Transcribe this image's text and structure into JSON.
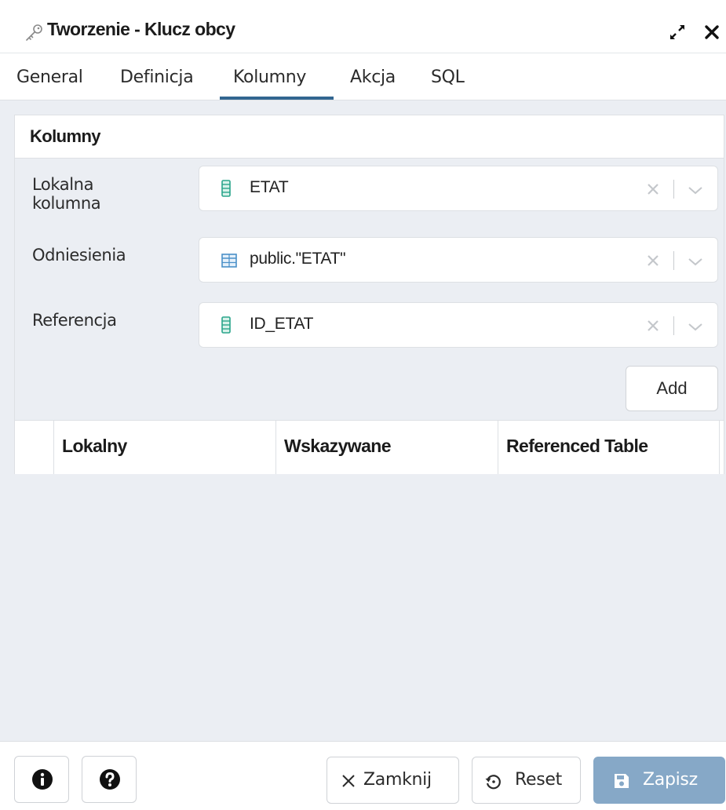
{
  "dialog": {
    "title": "Tworzenie - Klucz obcy",
    "title_icon": "key-icon",
    "expand_icon": "expand-icon",
    "close_icon": "close-icon"
  },
  "tabs": [
    {
      "label": "General",
      "active": false
    },
    {
      "label": "Definicja",
      "active": false
    },
    {
      "label": "Kolumny",
      "active": true
    },
    {
      "label": "Akcja",
      "active": false
    },
    {
      "label": "SQL",
      "active": false
    }
  ],
  "panel": {
    "title": "Kolumny",
    "fields": [
      {
        "label_line1": "Lokalna",
        "label_line2": "kolumna",
        "value": "ETAT",
        "icon": "column-icon"
      },
      {
        "label": "Odniesienia",
        "value": "public.\"ETAT\"",
        "icon": "table-icon"
      },
      {
        "label": "Referencja",
        "value": "ID_ETAT",
        "icon": "column-icon"
      }
    ],
    "add_label": "Add",
    "grid_columns": [
      "Lokalny",
      "Wskazywane",
      "Referenced Table"
    ]
  },
  "footer": {
    "info_icon": "info-icon",
    "help_icon": "help-icon",
    "close_label": "Zamknij",
    "reset_label": "Reset",
    "save_label": "Zapisz"
  },
  "colors": {
    "accent": "#326690",
    "save_disabled": "#86a8c7",
    "column_icon": "#2aa58b",
    "table_icon": "#4a90c8",
    "panel_bg": "#ebeef3"
  }
}
